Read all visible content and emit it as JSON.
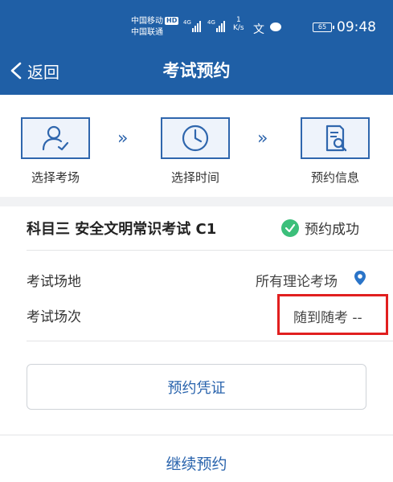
{
  "status_bar": {
    "carrier_1": "中国移动",
    "hd_badge": "HD",
    "carrier_2": "中国联通",
    "signal_1_label": "4G",
    "signal_2_label": "4G",
    "speed_value": "1",
    "speed_unit": "K/s",
    "battery_level": "65",
    "time": "09:48"
  },
  "nav": {
    "back_label": "返回",
    "title": "考试预约"
  },
  "steps": [
    {
      "label": "选择考场",
      "icon": "user-check-icon"
    },
    {
      "label": "选择时间",
      "icon": "clock-icon"
    },
    {
      "label": "预约信息",
      "icon": "document-search-icon"
    }
  ],
  "chevron": "»",
  "exam": {
    "title": "科目三 安全文明常识考试 C1",
    "status": "预约成功"
  },
  "details": {
    "venue_label": "考试场地",
    "venue_value": "所有理论考场",
    "session_label": "考试场次",
    "session_value": "随到随考 --"
  },
  "actions": {
    "voucher": "预约凭证",
    "continue": "继续预约"
  },
  "colors": {
    "header": "#1f5fa6",
    "accent": "#2a64ad",
    "success": "#3bbf7a",
    "highlight": "#e11f1f"
  }
}
